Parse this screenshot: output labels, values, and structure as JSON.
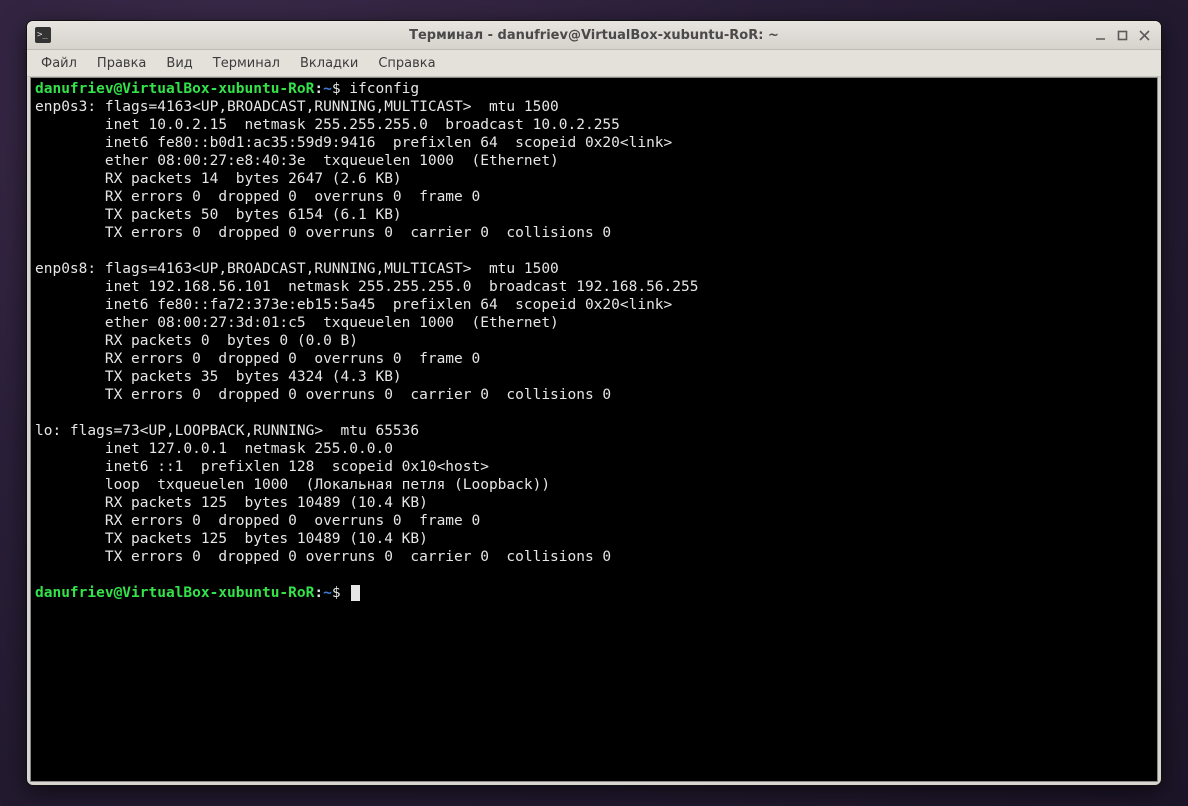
{
  "titlebar": {
    "title": "Терминал - danufriev@VirtualBox-xubuntu-RoR: ~"
  },
  "menubar": {
    "items": [
      "Файл",
      "Правка",
      "Вид",
      "Терминал",
      "Вкладки",
      "Справка"
    ]
  },
  "prompt": {
    "user_host": "danufriev@VirtualBox-xubuntu-RoR",
    "colon": ":",
    "path": "~",
    "dollar": "$ "
  },
  "command": "ifconfig",
  "output": "enp0s3: flags=4163<UP,BROADCAST,RUNNING,MULTICAST>  mtu 1500\n        inet 10.0.2.15  netmask 255.255.255.0  broadcast 10.0.2.255\n        inet6 fe80::b0d1:ac35:59d9:9416  prefixlen 64  scopeid 0x20<link>\n        ether 08:00:27:e8:40:3e  txqueuelen 1000  (Ethernet)\n        RX packets 14  bytes 2647 (2.6 KB)\n        RX errors 0  dropped 0  overruns 0  frame 0\n        TX packets 50  bytes 6154 (6.1 KB)\n        TX errors 0  dropped 0 overruns 0  carrier 0  collisions 0\n\nenp0s8: flags=4163<UP,BROADCAST,RUNNING,MULTICAST>  mtu 1500\n        inet 192.168.56.101  netmask 255.255.255.0  broadcast 192.168.56.255\n        inet6 fe80::fa72:373e:eb15:5a45  prefixlen 64  scopeid 0x20<link>\n        ether 08:00:27:3d:01:c5  txqueuelen 1000  (Ethernet)\n        RX packets 0  bytes 0 (0.0 B)\n        RX errors 0  dropped 0  overruns 0  frame 0\n        TX packets 35  bytes 4324 (4.3 KB)\n        TX errors 0  dropped 0 overruns 0  carrier 0  collisions 0\n\nlo: flags=73<UP,LOOPBACK,RUNNING>  mtu 65536\n        inet 127.0.0.1  netmask 255.0.0.0\n        inet6 ::1  prefixlen 128  scopeid 0x10<host>\n        loop  txqueuelen 1000  (Локальная петля (Loopback))\n        RX packets 125  bytes 10489 (10.4 KB)\n        RX errors 0  dropped 0  overruns 0  frame 0\n        TX packets 125  bytes 10489 (10.4 KB)\n        TX errors 0  dropped 0 overruns 0  carrier 0  collisions 0\n"
}
